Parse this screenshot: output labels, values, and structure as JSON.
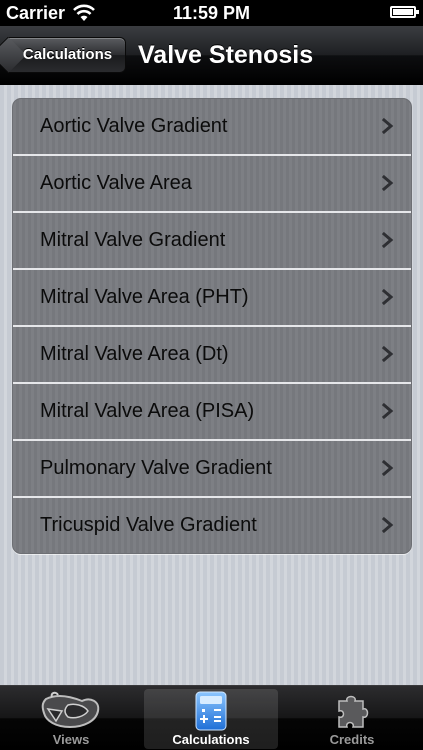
{
  "status_bar": {
    "carrier": "Carrier",
    "time": "11:59 PM",
    "wifi_icon": "wifi-icon",
    "battery_icon": "battery-icon"
  },
  "nav_bar": {
    "back_label": "Calculations",
    "title": "Valve Stenosis"
  },
  "list": {
    "items": [
      {
        "label": "Aortic Valve Gradient"
      },
      {
        "label": "Aortic Valve Area"
      },
      {
        "label": "Mitral Valve Gradient"
      },
      {
        "label": "Mitral Valve Area (PHT)"
      },
      {
        "label": "Mitral Valve Area (Dt)"
      },
      {
        "label": "Mitral Valve Area (PISA)"
      },
      {
        "label": "Pulmonary Valve Gradient"
      },
      {
        "label": "Tricuspid Valve Gradient"
      }
    ],
    "disclosure_icon": "chevron-right-icon"
  },
  "tab_bar": {
    "tabs": [
      {
        "label": "Views",
        "icon": "heart-echo-icon",
        "selected": false
      },
      {
        "label": "Calculations",
        "icon": "calculator-icon",
        "selected": true
      },
      {
        "label": "Credits",
        "icon": "puzzle-piece-icon",
        "selected": false
      }
    ]
  },
  "colors": {
    "accent_tab_icon": "#3c8fe0",
    "row_background": "#7a7c81",
    "nav_bar": "#1e1f22"
  }
}
